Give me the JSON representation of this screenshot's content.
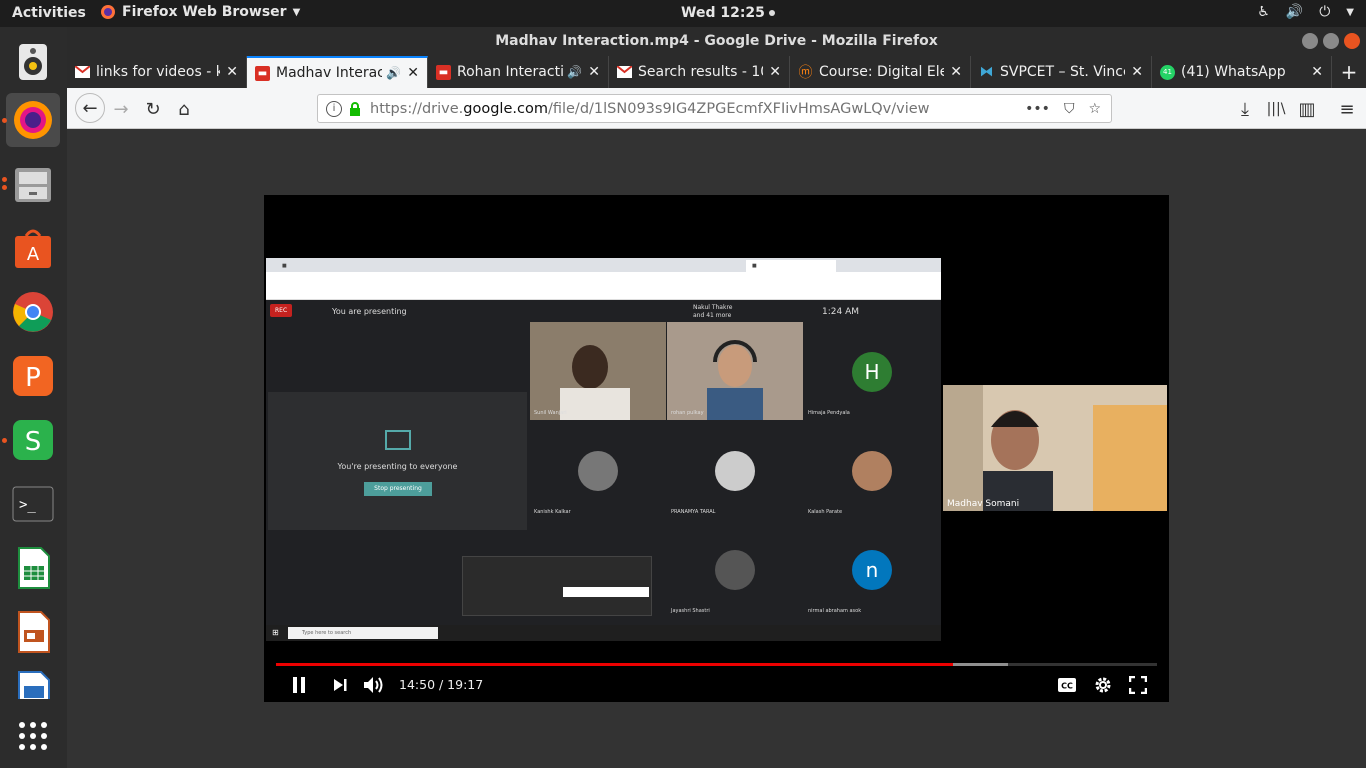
{
  "topbar": {
    "activities": "Activities",
    "app_name": "Firefox Web Browser",
    "clock": "Wed 12:25"
  },
  "window": {
    "title": "Madhav Interaction.mp4 - Google Drive - Mozilla Firefox"
  },
  "tabs": [
    {
      "label": "links for videos - k",
      "favicon": "gmail",
      "audio": false
    },
    {
      "label": "Madhav Interac",
      "favicon": "drive-video",
      "audio": true
    },
    {
      "label": "Rohan Interacti",
      "favicon": "drive-video",
      "audio": true
    },
    {
      "label": "Search results - 10",
      "favicon": "gmail",
      "audio": false
    },
    {
      "label": "Course: Digital Ele",
      "favicon": "moodle",
      "audio": false
    },
    {
      "label": "SVPCET – St. Vince",
      "favicon": "svpcet",
      "audio": false
    },
    {
      "label": "(41) WhatsApp",
      "favicon": "whatsapp",
      "badge": "41",
      "audio": false
    }
  ],
  "url": {
    "prefix": "https://drive.",
    "domain": "google.com",
    "path": "/file/d/1lSN093s9IG4ZPGEcmfXFIivHmsAGwLQv/view"
  },
  "video": {
    "meet": {
      "rec": "REC",
      "presenting": "You are presenting",
      "host_line1": "Nakul Thakre",
      "host_line2": "and 41 more",
      "time": "1:24 AM",
      "presenting_everyone": "You're presenting to everyone",
      "stop_button": "Stop presenting",
      "taskbar_search": "Type here to search"
    },
    "participants": [
      {
        "name": "Sunil Wanjari",
        "type": "video"
      },
      {
        "name": "rohan pulkay",
        "type": "video"
      },
      {
        "name": "Himaja Pendyala",
        "type": "letter",
        "letter": "H",
        "color": "#2e7d32"
      },
      {
        "name": "Kanishk Kalkar",
        "type": "photo"
      },
      {
        "name": "PRANAMYA TARAL",
        "type": "photo"
      },
      {
        "name": "Kalash Parate",
        "type": "photo"
      },
      {
        "name": "Jayashri Shastri",
        "type": "photo"
      },
      {
        "name": "nirmal abraham asok",
        "type": "letter",
        "letter": "n",
        "color": "#0277bd"
      }
    ],
    "self_cam": "Madhav Somani",
    "current_time": "14:50",
    "duration": "19:17",
    "time_display": "14:50 / 19:17",
    "played_fraction": 0.769,
    "buffered_fraction": 0.831
  }
}
